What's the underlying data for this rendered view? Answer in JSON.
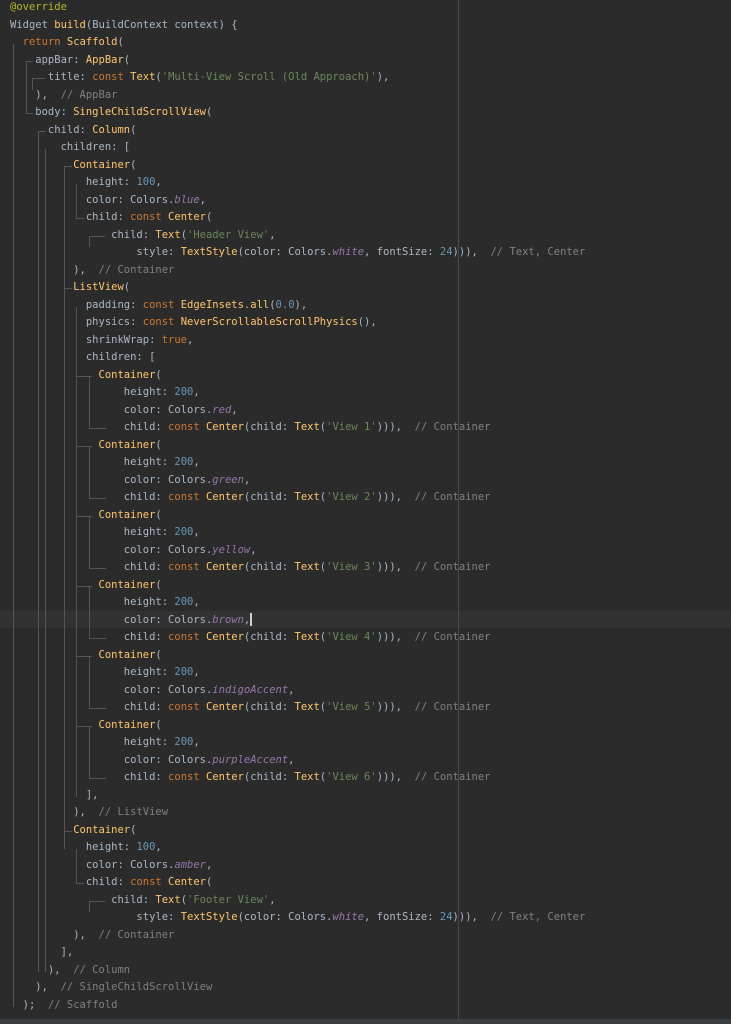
{
  "editor": {
    "language": "dart",
    "theme": "darcula",
    "current_line": 35,
    "lines": [
      [
        [
          "@override",
          "ann"
        ]
      ],
      [
        [
          "Widget ",
          "ty"
        ],
        [
          "build",
          "fn"
        ],
        [
          "(BuildContext context) {",
          "pl"
        ]
      ],
      [
        [
          "  "
        ],
        [
          "return ",
          "kw"
        ],
        [
          "Scaffold",
          "fn"
        ],
        [
          "(",
          "pl"
        ]
      ],
      [
        [
          "    appBar: ",
          "pl"
        ],
        [
          "AppBar",
          "fn"
        ],
        [
          "(",
          "pl"
        ]
      ],
      [
        [
          "      title: ",
          "pl"
        ],
        [
          "const ",
          "kw"
        ],
        [
          "Text",
          "fn"
        ],
        [
          "(",
          "pl"
        ],
        [
          "'Multi-View Scroll (Old Approach)'",
          "str"
        ],
        [
          "),",
          "pl"
        ]
      ],
      [
        [
          "    ),  ",
          "pl"
        ],
        [
          "// AppBar",
          "cm"
        ]
      ],
      [
        [
          "    body: ",
          "pl"
        ],
        [
          "SingleChildScrollView",
          "fn"
        ],
        [
          "(",
          "pl"
        ]
      ],
      [
        [
          "      child: ",
          "pl"
        ],
        [
          "Column",
          "fn"
        ],
        [
          "(",
          "pl"
        ]
      ],
      [
        [
          "        children: [",
          "pl"
        ]
      ],
      [
        [
          "          "
        ],
        [
          "Container",
          "fn"
        ],
        [
          "(",
          "pl"
        ]
      ],
      [
        [
          "            height: ",
          "pl"
        ],
        [
          "100",
          "num"
        ],
        [
          ",",
          "pl"
        ]
      ],
      [
        [
          "            color: Colors.",
          "pl"
        ],
        [
          "blue",
          "it"
        ],
        [
          ",",
          "pl"
        ]
      ],
      [
        [
          "            child: ",
          "pl"
        ],
        [
          "const ",
          "kw"
        ],
        [
          "Center",
          "fn"
        ],
        [
          "(",
          "pl"
        ]
      ],
      [
        [
          "                child: ",
          "pl"
        ],
        [
          "Text",
          "fn"
        ],
        [
          "(",
          "pl"
        ],
        [
          "'Header View'",
          "str"
        ],
        [
          ",",
          "pl"
        ]
      ],
      [
        [
          "                    style: ",
          "pl"
        ],
        [
          "TextStyle",
          "fn"
        ],
        [
          "(color: Colors.",
          "pl"
        ],
        [
          "white",
          "it"
        ],
        [
          ", fontSize: ",
          "pl"
        ],
        [
          "24",
          "num"
        ],
        [
          "))),  ",
          "pl"
        ],
        [
          "// Text, Center",
          "cm"
        ]
      ],
      [
        [
          "          ),  ",
          "pl"
        ],
        [
          "// Container",
          "cm"
        ]
      ],
      [
        [
          "          "
        ],
        [
          "ListView",
          "fn"
        ],
        [
          "(",
          "pl"
        ]
      ],
      [
        [
          "            padding: ",
          "pl"
        ],
        [
          "const ",
          "kw"
        ],
        [
          "EdgeInsets",
          "fn"
        ],
        [
          ".",
          "pl"
        ],
        [
          "all",
          "fn"
        ],
        [
          "(",
          "pl"
        ],
        [
          "0.0",
          "num"
        ],
        [
          "),",
          "pl"
        ]
      ],
      [
        [
          "            physics: ",
          "pl"
        ],
        [
          "const ",
          "kw"
        ],
        [
          "NeverScrollableScrollPhysics",
          "fn"
        ],
        [
          "(),",
          "pl"
        ]
      ],
      [
        [
          "            shrinkWrap: ",
          "pl"
        ],
        [
          "true",
          "kw"
        ],
        [
          ",",
          "pl"
        ]
      ],
      [
        [
          "            children: [",
          "pl"
        ]
      ],
      [
        [
          "              "
        ],
        [
          "Container",
          "fn"
        ],
        [
          "(",
          "pl"
        ]
      ],
      [
        [
          "                  height: ",
          "pl"
        ],
        [
          "200",
          "num"
        ],
        [
          ",",
          "pl"
        ]
      ],
      [
        [
          "                  color: Colors.",
          "pl"
        ],
        [
          "red",
          "it"
        ],
        [
          ",",
          "pl"
        ]
      ],
      [
        [
          "                  child: ",
          "pl"
        ],
        [
          "const ",
          "kw"
        ],
        [
          "Center",
          "fn"
        ],
        [
          "(child: ",
          "pl"
        ],
        [
          "Text",
          "fn"
        ],
        [
          "(",
          "pl"
        ],
        [
          "'View 1'",
          "str"
        ],
        [
          "))),  ",
          "pl"
        ],
        [
          "// Container",
          "cm"
        ]
      ],
      [
        [
          "              "
        ],
        [
          "Container",
          "fn"
        ],
        [
          "(",
          "pl"
        ]
      ],
      [
        [
          "                  height: ",
          "pl"
        ],
        [
          "200",
          "num"
        ],
        [
          ",",
          "pl"
        ]
      ],
      [
        [
          "                  color: Colors.",
          "pl"
        ],
        [
          "green",
          "it"
        ],
        [
          ",",
          "pl"
        ]
      ],
      [
        [
          "                  child: ",
          "pl"
        ],
        [
          "const ",
          "kw"
        ],
        [
          "Center",
          "fn"
        ],
        [
          "(child: ",
          "pl"
        ],
        [
          "Text",
          "fn"
        ],
        [
          "(",
          "pl"
        ],
        [
          "'View 2'",
          "str"
        ],
        [
          "))),  ",
          "pl"
        ],
        [
          "// Container",
          "cm"
        ]
      ],
      [
        [
          "              "
        ],
        [
          "Container",
          "fn"
        ],
        [
          "(",
          "pl"
        ]
      ],
      [
        [
          "                  height: ",
          "pl"
        ],
        [
          "200",
          "num"
        ],
        [
          ",",
          "pl"
        ]
      ],
      [
        [
          "                  color: Colors.",
          "pl"
        ],
        [
          "yellow",
          "it"
        ],
        [
          ",",
          "pl"
        ]
      ],
      [
        [
          "                  child: ",
          "pl"
        ],
        [
          "const ",
          "kw"
        ],
        [
          "Center",
          "fn"
        ],
        [
          "(child: ",
          "pl"
        ],
        [
          "Text",
          "fn"
        ],
        [
          "(",
          "pl"
        ],
        [
          "'View 3'",
          "str"
        ],
        [
          "))),  ",
          "pl"
        ],
        [
          "// Container",
          "cm"
        ]
      ],
      [
        [
          "              "
        ],
        [
          "Container",
          "fn"
        ],
        [
          "(",
          "pl"
        ]
      ],
      [
        [
          "                  height: ",
          "pl"
        ],
        [
          "200",
          "num"
        ],
        [
          ",",
          "pl"
        ]
      ],
      [
        [
          "                  color: Colors.",
          "pl"
        ],
        [
          "brown",
          "it"
        ],
        [
          ",",
          "pl"
        ],
        [
          "",
          "caret"
        ]
      ],
      [
        [
          "                  child: ",
          "pl"
        ],
        [
          "const ",
          "kw"
        ],
        [
          "Center",
          "fn"
        ],
        [
          "(child: ",
          "pl"
        ],
        [
          "Text",
          "fn"
        ],
        [
          "(",
          "pl"
        ],
        [
          "'View 4'",
          "str"
        ],
        [
          "))),  ",
          "pl"
        ],
        [
          "// Container",
          "cm"
        ]
      ],
      [
        [
          "              "
        ],
        [
          "Container",
          "fn"
        ],
        [
          "(",
          "pl"
        ]
      ],
      [
        [
          "                  height: ",
          "pl"
        ],
        [
          "200",
          "num"
        ],
        [
          ",",
          "pl"
        ]
      ],
      [
        [
          "                  color: Colors.",
          "pl"
        ],
        [
          "indigoAccent",
          "it"
        ],
        [
          ",",
          "pl"
        ]
      ],
      [
        [
          "                  child: ",
          "pl"
        ],
        [
          "const ",
          "kw"
        ],
        [
          "Center",
          "fn"
        ],
        [
          "(child: ",
          "pl"
        ],
        [
          "Text",
          "fn"
        ],
        [
          "(",
          "pl"
        ],
        [
          "'View 5'",
          "str"
        ],
        [
          "))),  ",
          "pl"
        ],
        [
          "// Container",
          "cm"
        ]
      ],
      [
        [
          "              "
        ],
        [
          "Container",
          "fn"
        ],
        [
          "(",
          "pl"
        ]
      ],
      [
        [
          "                  height: ",
          "pl"
        ],
        [
          "200",
          "num"
        ],
        [
          ",",
          "pl"
        ]
      ],
      [
        [
          "                  color: Colors.",
          "pl"
        ],
        [
          "purpleAccent",
          "it"
        ],
        [
          ",",
          "pl"
        ]
      ],
      [
        [
          "                  child: ",
          "pl"
        ],
        [
          "const ",
          "kw"
        ],
        [
          "Center",
          "fn"
        ],
        [
          "(child: ",
          "pl"
        ],
        [
          "Text",
          "fn"
        ],
        [
          "(",
          "pl"
        ],
        [
          "'View 6'",
          "str"
        ],
        [
          "))),  ",
          "pl"
        ],
        [
          "// Container",
          "cm"
        ]
      ],
      [
        [
          "            ],",
          "pl"
        ]
      ],
      [
        [
          "          ),  ",
          "pl"
        ],
        [
          "// ListView",
          "cm"
        ]
      ],
      [
        [
          "          "
        ],
        [
          "Container",
          "fn"
        ],
        [
          "(",
          "pl"
        ]
      ],
      [
        [
          "            height: ",
          "pl"
        ],
        [
          "100",
          "num"
        ],
        [
          ",",
          "pl"
        ]
      ],
      [
        [
          "            color: Colors.",
          "pl"
        ],
        [
          "amber",
          "it"
        ],
        [
          ",",
          "pl"
        ]
      ],
      [
        [
          "            child: ",
          "pl"
        ],
        [
          "const ",
          "kw"
        ],
        [
          "Center",
          "fn"
        ],
        [
          "(",
          "pl"
        ]
      ],
      [
        [
          "                child: ",
          "pl"
        ],
        [
          "Text",
          "fn"
        ],
        [
          "(",
          "pl"
        ],
        [
          "'Footer View'",
          "str"
        ],
        [
          ",",
          "pl"
        ]
      ],
      [
        [
          "                    style: ",
          "pl"
        ],
        [
          "TextStyle",
          "fn"
        ],
        [
          "(color: Colors.",
          "pl"
        ],
        [
          "white",
          "it"
        ],
        [
          ", fontSize: ",
          "pl"
        ],
        [
          "24",
          "num"
        ],
        [
          "))),  ",
          "pl"
        ],
        [
          "// Text, Center",
          "cm"
        ]
      ],
      [
        [
          "          ),  ",
          "pl"
        ],
        [
          "// Container",
          "cm"
        ]
      ],
      [
        [
          "        ],",
          "pl"
        ]
      ],
      [
        [
          "      ),  ",
          "pl"
        ],
        [
          "// Column",
          "cm"
        ]
      ],
      [
        [
          "    ),  ",
          "pl"
        ],
        [
          "// SingleChildScrollView",
          "cm"
        ]
      ],
      [
        [
          "  );  ",
          "pl"
        ],
        [
          "// Scaffold",
          "cm"
        ]
      ]
    ]
  }
}
